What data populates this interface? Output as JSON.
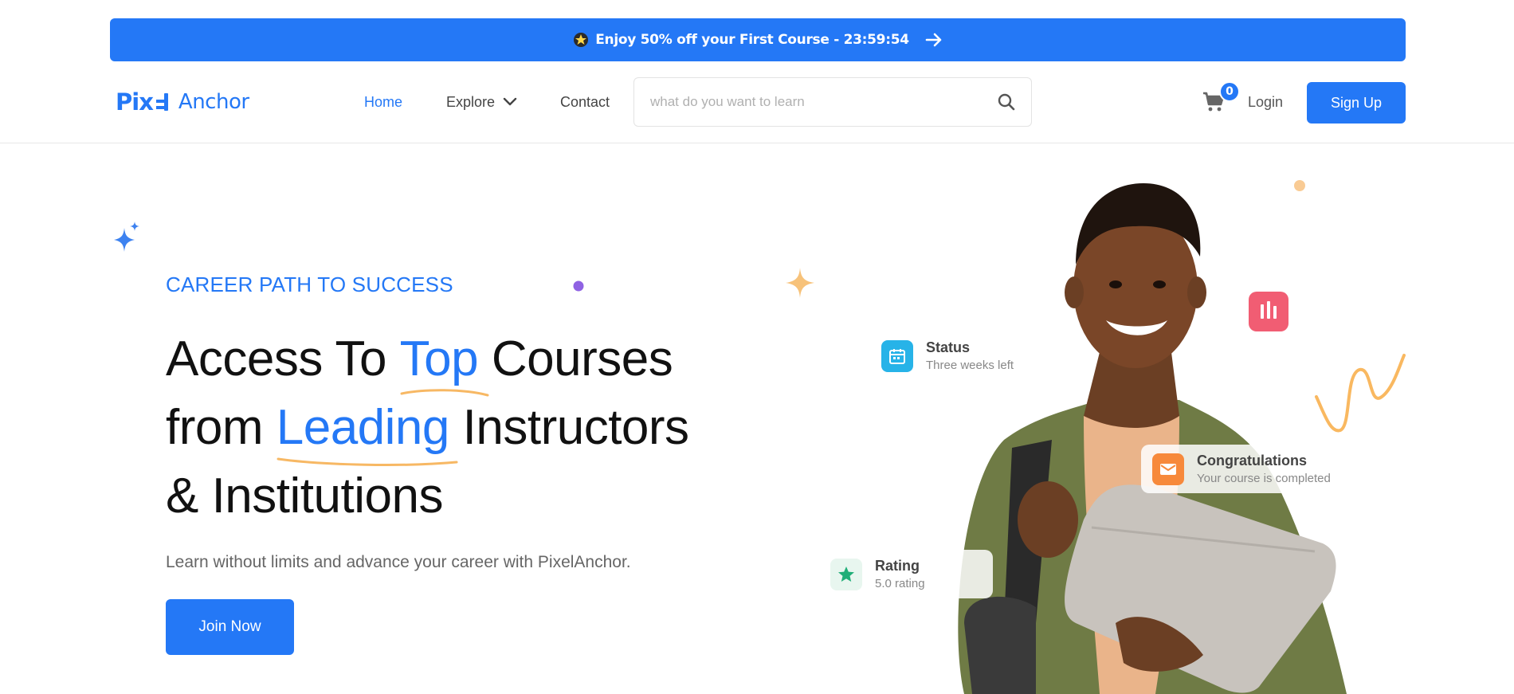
{
  "promo": {
    "text": "Enjoy 50% off your First Course - 23:59:54",
    "star_icon": "star-emoji-icon",
    "arrow_icon": "arrow-right-icon",
    "color": "#2478f6"
  },
  "header": {
    "logo_left": "Pix",
    "logo_right": "Anchor",
    "nav": {
      "home": "Home",
      "explore": "Explore",
      "contact": "Contact"
    },
    "search_placeholder": "what do you want to learn",
    "cart_count": "0",
    "login": "Login",
    "signup": "Sign Up"
  },
  "hero": {
    "eyebrow": "CAREER PATH TO SUCCESS",
    "headline_1a": "Access To ",
    "headline_1b": "Top",
    "headline_1c": " Courses",
    "headline_2a": "from ",
    "headline_2b": "Leading",
    "headline_2c": " Instructors",
    "headline_3": "& Institutions",
    "subtitle": "Learn without limits and advance your career with PixelAnchor.",
    "cta": "Join Now"
  },
  "cards": {
    "status": {
      "title": "Status",
      "subtitle": "Three weeks left",
      "icon": "calendar-icon"
    },
    "congrats": {
      "title": "Congratulations",
      "subtitle": "Your course is completed",
      "icon": "mail-icon"
    },
    "rating": {
      "title": "Rating",
      "subtitle": "5.0 rating",
      "icon": "star-icon"
    },
    "chart_icon": "bar-chart-icon"
  },
  "colors": {
    "accent": "#2478f6",
    "underline": "#f7b864",
    "status_icon": "#27b3e8",
    "congrats_icon": "#f7893b",
    "rating_icon": "#1fae77",
    "chart_badge": "#f0546c"
  }
}
